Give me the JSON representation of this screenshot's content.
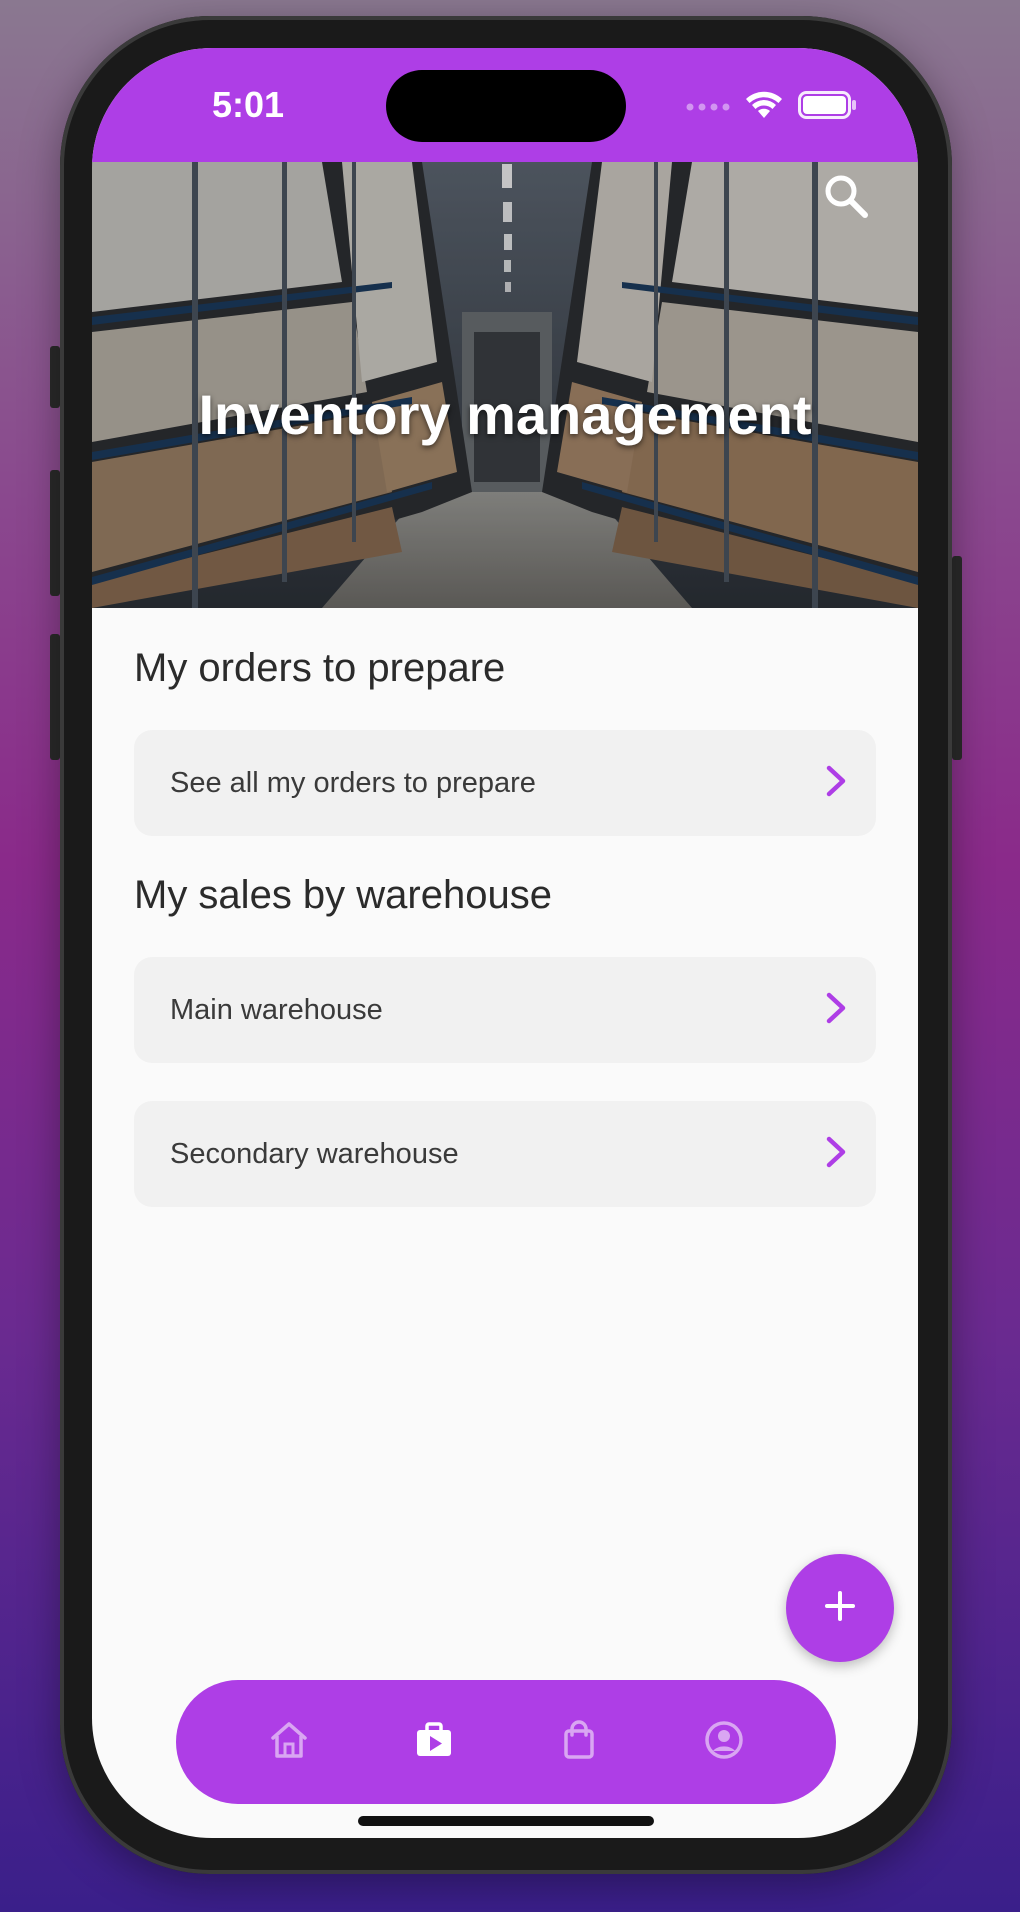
{
  "status_bar": {
    "time": "5:01",
    "icons": [
      "signal-dots-icon",
      "wifi-icon",
      "battery-icon"
    ]
  },
  "hero": {
    "title": "Inventory management",
    "search_icon": "search-icon"
  },
  "sections": [
    {
      "title": "My orders to prepare",
      "items": [
        {
          "label": "See all my orders to prepare",
          "icon": "chevron-right-icon"
        }
      ]
    },
    {
      "title": "My sales by warehouse",
      "items": [
        {
          "label": "Main warehouse",
          "icon": "chevron-right-icon"
        },
        {
          "label": "Secondary warehouse",
          "icon": "chevron-right-icon"
        }
      ]
    }
  ],
  "fab": {
    "icon": "plus-icon"
  },
  "bottom_nav": {
    "items": [
      {
        "icon": "home-icon",
        "active": false
      },
      {
        "icon": "briefcase-icon",
        "active": true
      },
      {
        "icon": "shopping-bag-icon",
        "active": false
      },
      {
        "icon": "profile-icon",
        "active": false
      }
    ]
  },
  "colors": {
    "accent": "#ae3ee6",
    "card_bg": "#f1f1f1",
    "page_bg": "#fafafa",
    "text": "#2b2b2b"
  }
}
